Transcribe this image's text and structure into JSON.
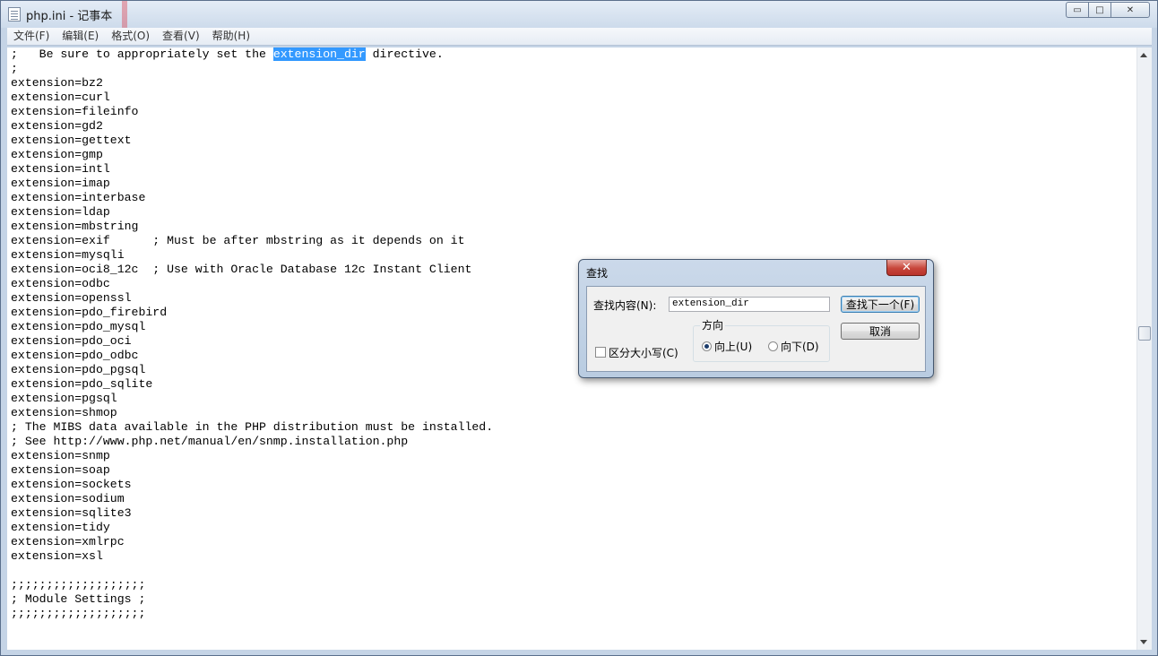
{
  "window": {
    "title": "php.ini - 记事本",
    "buttons": {
      "minimize": "▭",
      "maximize": "□",
      "close": "✕"
    }
  },
  "menu": [
    "文件(F)",
    "编辑(E)",
    "格式(O)",
    "查看(V)",
    "帮助(H)"
  ],
  "editor": {
    "first_line": {
      "before": ";   Be sure to appropriately set the ",
      "highlight": "extension_dir",
      "after": " directive."
    },
    "lines": [
      ";",
      "extension=bz2",
      "extension=curl",
      "extension=fileinfo",
      "extension=gd2",
      "extension=gettext",
      "extension=gmp",
      "extension=intl",
      "extension=imap",
      "extension=interbase",
      "extension=ldap",
      "extension=mbstring",
      "extension=exif      ; Must be after mbstring as it depends on it",
      "extension=mysqli",
      "extension=oci8_12c  ; Use with Oracle Database 12c Instant Client",
      "extension=odbc",
      "extension=openssl",
      "extension=pdo_firebird",
      "extension=pdo_mysql",
      "extension=pdo_oci",
      "extension=pdo_odbc",
      "extension=pdo_pgsql",
      "extension=pdo_sqlite",
      "extension=pgsql",
      "extension=shmop",
      "; The MIBS data available in the PHP distribution must be installed.",
      "; See http://www.php.net/manual/en/snmp.installation.php",
      "extension=snmp",
      "extension=soap",
      "extension=sockets",
      "extension=sodium",
      "extension=sqlite3",
      "extension=tidy",
      "extension=xmlrpc",
      "extension=xsl",
      "",
      ";;;;;;;;;;;;;;;;;;;",
      "; Module Settings ;",
      ";;;;;;;;;;;;;;;;;;;"
    ]
  },
  "find_dialog": {
    "title": "查找",
    "close_label": "✕",
    "find_label": "查找内容(N):",
    "find_value": "extension_dir",
    "find_next": "查找下一个(F)",
    "cancel": "取消",
    "direction_label": "方向",
    "up_label": "向上(U)",
    "down_label": "向下(D)",
    "direction_selected": "up",
    "match_case_label": "区分大小写(C)",
    "match_case": false
  }
}
